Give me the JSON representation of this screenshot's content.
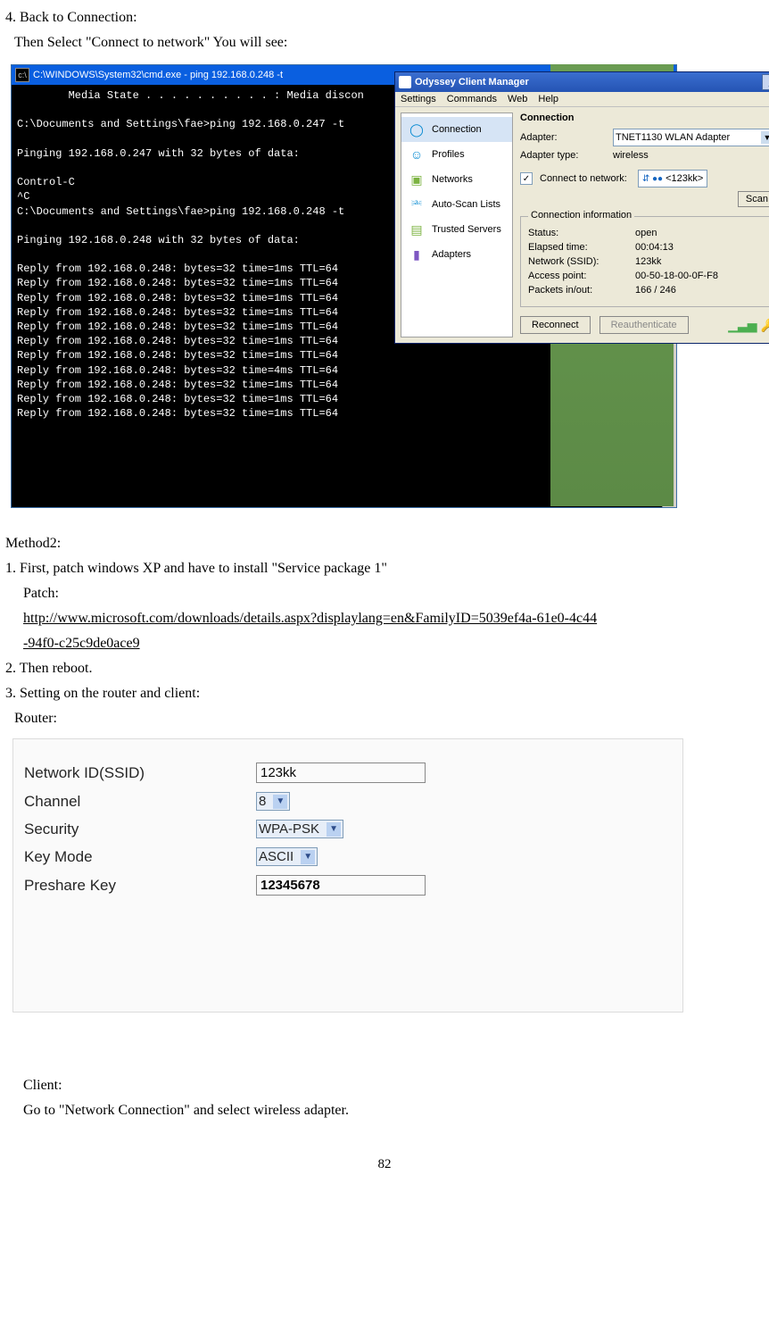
{
  "doc": {
    "step4": "4. Back to Connection:",
    "step4b": "Then Select \"Connect to network\" You will see:",
    "method2": "Method2:",
    "m2_1": "1. First, patch windows XP and have to install \"Service package 1\"",
    "patch_label": "Patch:",
    "patch_url1": "http://www.microsoft.com/downloads/details.aspx?displaylang=en&FamilyID=5039ef4a-61e0-4c44",
    "patch_url2": "-94f0-c25c9de0ace9",
    "m2_2": "2. Then reboot.",
    "m2_3": "3. Setting on the router and client:",
    "router_label": "Router:",
    "client_label": "Client:",
    "client_text": "Go to \"Network Connection\" and select wireless adapter.",
    "page_num": "82"
  },
  "cmd": {
    "title": "C:\\WINDOWS\\System32\\cmd.exe - ping 192.168.0.248 -t",
    "body": "        Media State . . . . . . . . . . : Media discon\n\nC:\\Documents and Settings\\fae>ping 192.168.0.247 -t\n\nPinging 192.168.0.247 with 32 bytes of data:\n\nControl-C\n^C\nC:\\Documents and Settings\\fae>ping 192.168.0.248 -t\n\nPinging 192.168.0.248 with 32 bytes of data:\n\nReply from 192.168.0.248: bytes=32 time=1ms TTL=64\nReply from 192.168.0.248: bytes=32 time=1ms TTL=64\nReply from 192.168.0.248: bytes=32 time=1ms TTL=64\nReply from 192.168.0.248: bytes=32 time=1ms TTL=64\nReply from 192.168.0.248: bytes=32 time=1ms TTL=64\nReply from 192.168.0.248: bytes=32 time=1ms TTL=64\nReply from 192.168.0.248: bytes=32 time=1ms TTL=64\nReply from 192.168.0.248: bytes=32 time=4ms TTL=64\nReply from 192.168.0.248: bytes=32 time=1ms TTL=64\nReply from 192.168.0.248: bytes=32 time=1ms TTL=64\nReply from 192.168.0.248: bytes=32 time=1ms TTL=64"
  },
  "odyssey": {
    "title": "Odyssey Client Manager",
    "menu": {
      "settings": "Settings",
      "commands": "Commands",
      "web": "Web",
      "help": "Help"
    },
    "side": {
      "connection": "Connection",
      "profiles": "Profiles",
      "networks": "Networks",
      "autoscan": "Auto-Scan Lists",
      "trusted": "Trusted Servers",
      "adapters": "Adapters"
    },
    "main": {
      "heading": "Connection",
      "adapter_lbl": "Adapter:",
      "adapter_val": "TNET1130 WLAN Adapter",
      "atype_lbl": "Adapter type:",
      "atype_val": "wireless",
      "connect_lbl": "Connect to network:",
      "connect_val": "<123kk>",
      "scan": "Scan",
      "group": "Connection information",
      "status_l": "Status:",
      "status_v": "open",
      "elapsed_l": "Elapsed time:",
      "elapsed_v": "00:04:13",
      "ssid_l": "Network (SSID):",
      "ssid_v": "123kk",
      "ap_l": "Access point:",
      "ap_v": "00-50-18-00-0F-F8",
      "pkt_l": "Packets in/out:",
      "pkt_v": "166 / 246",
      "reconnect": "Reconnect",
      "reauth": "Reauthenticate"
    }
  },
  "router": {
    "ssid_l": "Network ID(SSID)",
    "ssid_v": "123kk",
    "channel_l": "Channel",
    "channel_v": "8",
    "security_l": "Security",
    "security_v": "WPA-PSK",
    "keymode_l": "Key Mode",
    "keymode_v": "ASCII",
    "psk_l": "Preshare Key",
    "psk_v": "12345678"
  }
}
